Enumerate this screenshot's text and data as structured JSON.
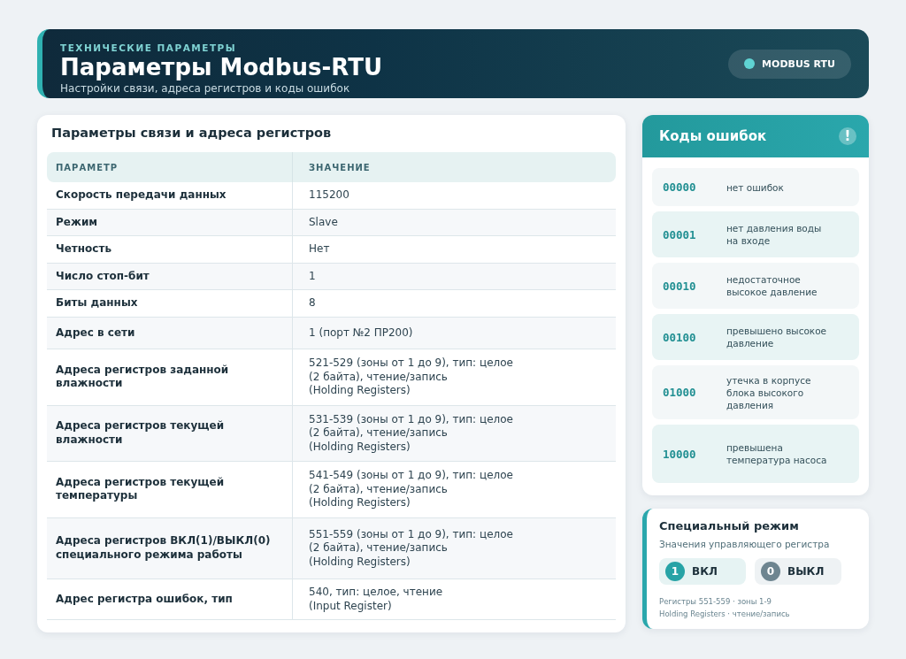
{
  "header": {
    "eyebrow": "ТЕХНИЧЕСКИЕ ПАРАМЕТРЫ",
    "title": "Параметры Modbus-RTU",
    "subtitle": "Настройки связи, адреса регистров и коды ошибок",
    "badge": "MODBUS RTU"
  },
  "params": {
    "title": "Параметры связи и адреса регистров",
    "columns": [
      "ПАРАМЕТР",
      "ЗНАЧЕНИЕ"
    ],
    "rows": [
      {
        "name": "Скорость передачи данных",
        "value": "115200"
      },
      {
        "name": "Режим",
        "value": "Slave"
      },
      {
        "name": "Четность",
        "value": "Нет"
      },
      {
        "name": "Число стоп-бит",
        "value": "1"
      },
      {
        "name": "Биты данных",
        "value": "8"
      },
      {
        "name": "Адрес в сети",
        "value": "1 (порт №2 ПР200)"
      },
      {
        "name": "Адреса регистров заданной\nвлажности",
        "value": "521-529 (зоны от 1 до 9), тип: целое\n(2 байта), чтение/запись\n(Holding Registers)"
      },
      {
        "name": "Адреса регистров текущей\nвлажности",
        "value": "531-539 (зоны от 1 до 9), тип: целое\n(2 байта), чтение/запись\n(Holding Registers)"
      },
      {
        "name": "Адреса регистров текущей\nтемпературы",
        "value": "541-549 (зоны от 1 до 9), тип: целое\n(2 байта), чтение/запись\n(Holding Registers)"
      },
      {
        "name": "Адреса регистров ВКЛ(1)/ВЫКЛ(0)\nспециального режима работы",
        "value": "551-559 (зоны от 1 до 9), тип: целое\n(2 байта), чтение/запись\n(Holding Registers)"
      },
      {
        "name": "Адрес регистра ошибок, тип",
        "value": "540, тип: целое, чтение\n(Input Register)"
      }
    ]
  },
  "errors": {
    "title": "Коды ошибок",
    "icon_text": "!",
    "items": [
      {
        "code": "00000",
        "text": "нет ошибок"
      },
      {
        "code": "00001",
        "text": "нет давления воды\nна входе"
      },
      {
        "code": "00010",
        "text": "недостаточное\nвысокое давление"
      },
      {
        "code": "00100",
        "text": "превышено высокое\nдавление"
      },
      {
        "code": "01000",
        "text": "утечка в корпусе\nблока высокого\nдавления"
      },
      {
        "code": "10000",
        "text": "превышена\nтемпература насоса"
      }
    ]
  },
  "special": {
    "title": "Специальный режим",
    "subtitle": "Значения управляющего регистра",
    "chips": [
      {
        "kind": "on",
        "value": "1",
        "label": "ВКЛ"
      },
      {
        "kind": "off",
        "value": "0",
        "label": "ВЫКЛ"
      }
    ],
    "notes": [
      "Регистры 551-559 · зоны 1-9",
      "Holding Registers · чтение/запись"
    ]
  }
}
